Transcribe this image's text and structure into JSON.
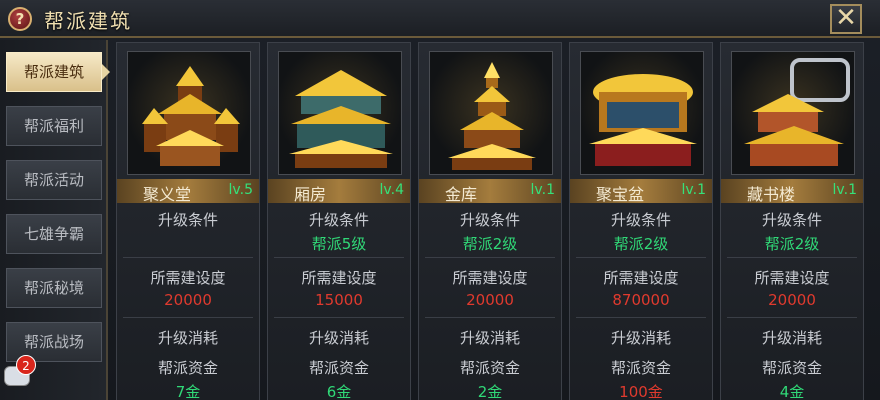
{
  "window": {
    "title": "帮派建筑",
    "help_label": "?",
    "close_label": "✕"
  },
  "sidebar": {
    "items": [
      {
        "label": "帮派建筑",
        "active": true
      },
      {
        "label": "帮派福利",
        "active": false
      },
      {
        "label": "帮派活动",
        "active": false
      },
      {
        "label": "七雄争霸",
        "active": false
      },
      {
        "label": "帮派秘境",
        "active": false
      },
      {
        "label": "帮派战场",
        "active": false
      }
    ],
    "chat_badge_count": "2"
  },
  "buildings": [
    {
      "name": "聚义堂",
      "level": "lv.5",
      "cond_label": "升级条件",
      "cond_value": "",
      "build_label": "所需建设度",
      "build_value": "20000",
      "cost_label": "升级消耗",
      "fund_label": "帮派资金",
      "fund_value": "7金"
    },
    {
      "name": "厢房",
      "level": "lv.4",
      "cond_label": "升级条件",
      "cond_value": "帮派5级",
      "build_label": "所需建设度",
      "build_value": "15000",
      "cost_label": "升级消耗",
      "fund_label": "帮派资金",
      "fund_value": "6金"
    },
    {
      "name": "金库",
      "level": "lv.1",
      "cond_label": "升级条件",
      "cond_value": "帮派2级",
      "build_label": "所需建设度",
      "build_value": "20000",
      "cost_label": "升级消耗",
      "fund_label": "帮派资金",
      "fund_value": "2金"
    },
    {
      "name": "聚宝盆",
      "level": "lv.1",
      "cond_label": "升级条件",
      "cond_value": "帮派2级",
      "build_label": "所需建设度",
      "build_value": "870000",
      "cost_label": "升级消耗",
      "fund_label": "帮派资金",
      "fund_value": "100金"
    },
    {
      "name": "藏书楼",
      "level": "lv.1",
      "cond_label": "升级条件",
      "cond_value": "帮派2级",
      "build_label": "所需建设度",
      "build_value": "20000",
      "cost_label": "升级消耗",
      "fund_label": "帮派资金",
      "fund_value": "4金"
    }
  ],
  "colors": {
    "accent_gold": "#a47c3d",
    "status_green": "#30d877",
    "requirement_red": "#e03a2e"
  }
}
